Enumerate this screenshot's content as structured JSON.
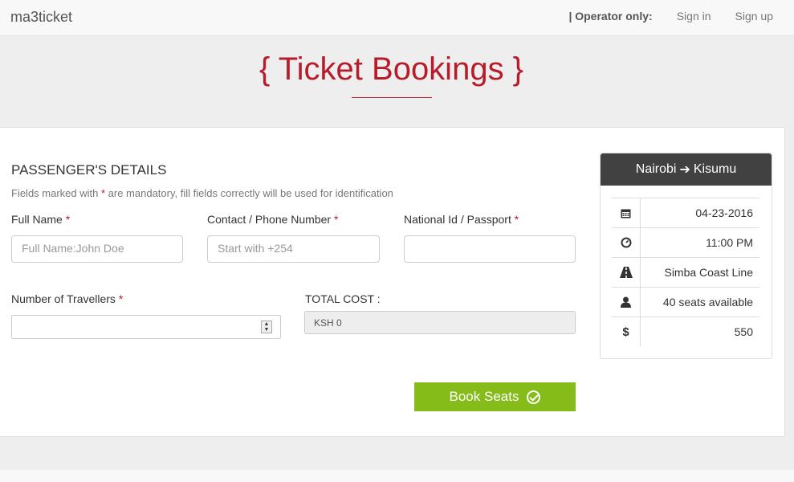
{
  "nav": {
    "brand": "ma3ticket",
    "operator_label": "| Operator only:",
    "sign_in": "Sign in",
    "sign_up": "Sign up"
  },
  "page": {
    "title": "{ Ticket Bookings }"
  },
  "form": {
    "section_title": "PASSENGER'S DETAILS",
    "hint_before": "Fields marked with ",
    "hint_star": "*",
    "hint_after": " are mandatory, fill fields correctly will be used for identification",
    "full_name_label": "Full Name",
    "full_name_placeholder": "Full Name:John Doe",
    "phone_label": "Contact / Phone Number",
    "phone_placeholder": "Start with +254",
    "national_id_label": "National Id / Passport",
    "national_id_value": "",
    "travellers_label": "Number of Travellers",
    "travellers_value": "",
    "required_mark": "*",
    "total_cost_label": "TOTAL COST :",
    "total_cost_value": "KSH 0",
    "book_button": "Book Seats"
  },
  "trip": {
    "from": "Nairobi",
    "to": "Kisumu",
    "rows": [
      {
        "icon": "calendar-icon",
        "value": "04-23-2016"
      },
      {
        "icon": "clock-icon",
        "value": "11:00 PM"
      },
      {
        "icon": "road-icon",
        "value": "Simba Coast Line"
      },
      {
        "icon": "user-icon",
        "value": "40 seats available"
      },
      {
        "icon": "dollar-icon",
        "value": "550"
      }
    ]
  },
  "colors": {
    "accent": "#b71c2b",
    "button": "#86bc1a",
    "panel_header": "#414141"
  }
}
